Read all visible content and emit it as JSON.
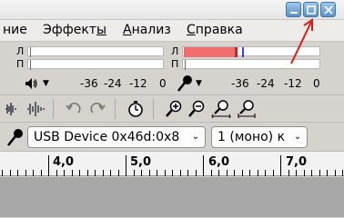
{
  "menu": {
    "items": [
      {
        "text": "ние",
        "ul": ""
      },
      {
        "text": "Эффекты",
        "ul": "ы"
      },
      {
        "text": "Анализ",
        "ul": "А"
      },
      {
        "text": "Справка",
        "ul": "С"
      }
    ]
  },
  "meters": {
    "left_letter_top": "Л",
    "left_letter_bottom": "П",
    "right_letter_top": "Л",
    "right_letter_bottom": "П",
    "playback_scale": [
      "-36",
      "-24",
      "-12",
      "0"
    ],
    "record_scale": [
      "-36",
      "-24",
      "-12",
      "0"
    ]
  },
  "device": {
    "input_device": "USB Device 0x46d:0x8",
    "channels": "1 (моно) к"
  },
  "ruler": {
    "labels": [
      "4,0",
      "5,0",
      "6,0",
      "7,0"
    ]
  },
  "colors": {
    "meter_red": "#f06e6e",
    "arrow": "#e01818",
    "window_button": "#5c92c7"
  },
  "icons": [
    "minimize-icon",
    "maximize-icon",
    "close-icon",
    "speaker-icon",
    "microphone-icon",
    "undo-icon",
    "redo-icon",
    "timer-icon",
    "zoom-in-icon",
    "zoom-out-icon",
    "fit-selection-icon",
    "fit-project-icon",
    "waveform-icon",
    "waveform-alt-icon"
  ]
}
